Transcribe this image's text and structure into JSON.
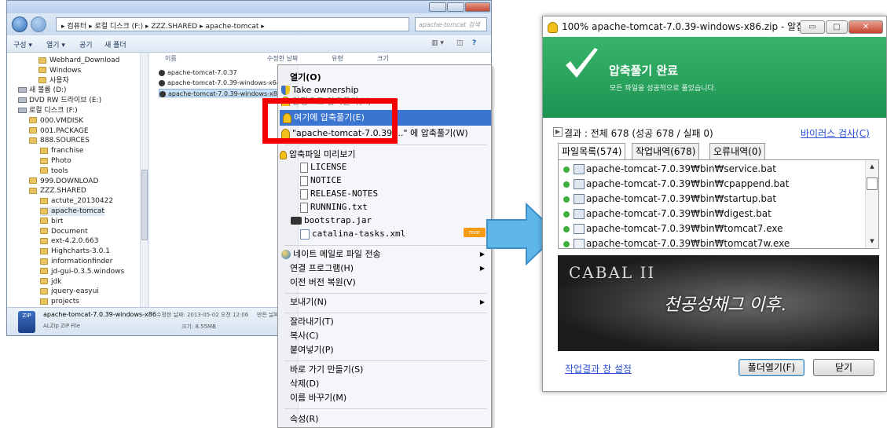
{
  "explorer": {
    "address": "▸ 컴퓨터 ▸ 로컬 디스크 (F:) ▸ ZZZ.SHARED ▸ apache-tomcat ▸",
    "search_placeholder": "apache-tomcat 검색",
    "toolbar": {
      "organize": "구성 ▾",
      "open": "열기 ▾",
      "share": "공기",
      "new_folder": "새 폴더"
    },
    "tree": [
      {
        "label": "Webhard_Download",
        "type": "folder"
      },
      {
        "label": "Windows",
        "type": "folder"
      },
      {
        "label": "사용자",
        "type": "folder"
      },
      {
        "label": "새 볼륨 (D:)",
        "type": "drive"
      },
      {
        "label": "DVD RW 드라이브 (E:)",
        "type": "drive"
      },
      {
        "label": "로컬 디스크 (F:)",
        "type": "drive"
      },
      {
        "label": "000.VMDISK",
        "type": "folder"
      },
      {
        "label": "001.PACKAGE",
        "type": "folder"
      },
      {
        "label": "888.SOURCES",
        "type": "folder"
      },
      {
        "label": "franchise",
        "type": "folder"
      },
      {
        "label": "Photo",
        "type": "folder"
      },
      {
        "label": "tools",
        "type": "folder"
      },
      {
        "label": "999.DOWNLOAD",
        "type": "folder"
      },
      {
        "label": "ZZZ.SHARED",
        "type": "folder"
      },
      {
        "label": "actute_20130422",
        "type": "folder"
      },
      {
        "label": "apache-tomcat",
        "type": "folder"
      },
      {
        "label": "birt",
        "type": "folder"
      },
      {
        "label": "Document",
        "type": "folder"
      },
      {
        "label": "ext-4.2.0.663",
        "type": "folder"
      },
      {
        "label": "Highcharts-3.0.1",
        "type": "folder"
      },
      {
        "label": "informationfinder",
        "type": "folder"
      },
      {
        "label": "jd-gui-0.3.5.windows",
        "type": "folder"
      },
      {
        "label": "jdk",
        "type": "folder"
      },
      {
        "label": "jquery-easyui",
        "type": "folder"
      },
      {
        "label": "projects",
        "type": "folder"
      }
    ],
    "columns": [
      "이름",
      "수정한 날짜",
      "유형",
      "크기"
    ],
    "files": [
      "apache-tomcat-7.0.37",
      "apache-tomcat-7.0.39-windows-x64",
      "apache-tomcat-7.0.39-windows-x86"
    ],
    "details": {
      "name": "apache-tomcat-7.0.39-windows-x86",
      "modified": "수정한 날짜: 2013-05-02 오전 12:06",
      "created_label": "만든 날짜",
      "type": "ALZip ZIP File",
      "size": "크기: 8.55MB",
      "zip_icon_text": "ZIP"
    }
  },
  "context_menu": {
    "open": "열기(O)",
    "take_ownership": "Take ownership",
    "hidden_item": "알집으로 압축풀기(X)",
    "extract_here": "여기에 압축풀기(E)",
    "extract_to": "\"apache-tomcat-7.0.39-...\" 에 압축풀기(W)",
    "preview": "압축파일 미리보기",
    "preview_files": [
      "LICENSE",
      "NOTICE",
      "RELEASE-NOTES",
      "RUNNING.txt",
      "bootstrap.jar",
      "catalina-tasks.xml"
    ],
    "more_badge": "mor",
    "send_mail": "네이트 메일로 파일 전송",
    "open_with": "연결 프로그램(H)",
    "restore": "이전 버전 복원(V)",
    "send_to": "보내기(N)",
    "cut": "잘라내기(T)",
    "copy": "복사(C)",
    "paste": "붙여넣기(P)",
    "shortcut": "바로 가기 만들기(S)",
    "delete": "삭제(D)",
    "rename": "이름 바꾸기(M)",
    "properties": "속성(R)"
  },
  "alzip": {
    "title": "100% apache-tomcat-7.0.39-windows-x86.zip - 알집",
    "done_title": "압축풀기 완료",
    "done_sub": "모든 파일을 성공적으로 풀었습니다.",
    "result": "결과 : 전체 678 (성공 678 / 실패 0)",
    "virus_scan": "바이러스 검사(C)",
    "tabs": [
      "파일목록(574)",
      "작업내역(678)",
      "오류내역(0)"
    ],
    "files": [
      "apache-tomcat-7.0.39₩bin₩service.bat",
      "apache-tomcat-7.0.39₩bin₩cpappend.bat",
      "apache-tomcat-7.0.39₩bin₩startup.bat",
      "apache-tomcat-7.0.39₩bin₩digest.bat",
      "apache-tomcat-7.0.39₩bin₩tomcat7.exe",
      "apache-tomcat-7.0.39₩bin₩tomcat7w.exe"
    ],
    "ad_logo": "CABAL II",
    "ad_slogan": "천공성채그 이후.",
    "settings_link": "작업결과 창 설정",
    "open_folder": "폴더열기(F)",
    "close": "닫기"
  },
  "colors": {
    "highlight": "#3a75d2",
    "callout": "#f40000",
    "alzip_green": "#2aa35e",
    "arrow": "#5fb6e8"
  }
}
